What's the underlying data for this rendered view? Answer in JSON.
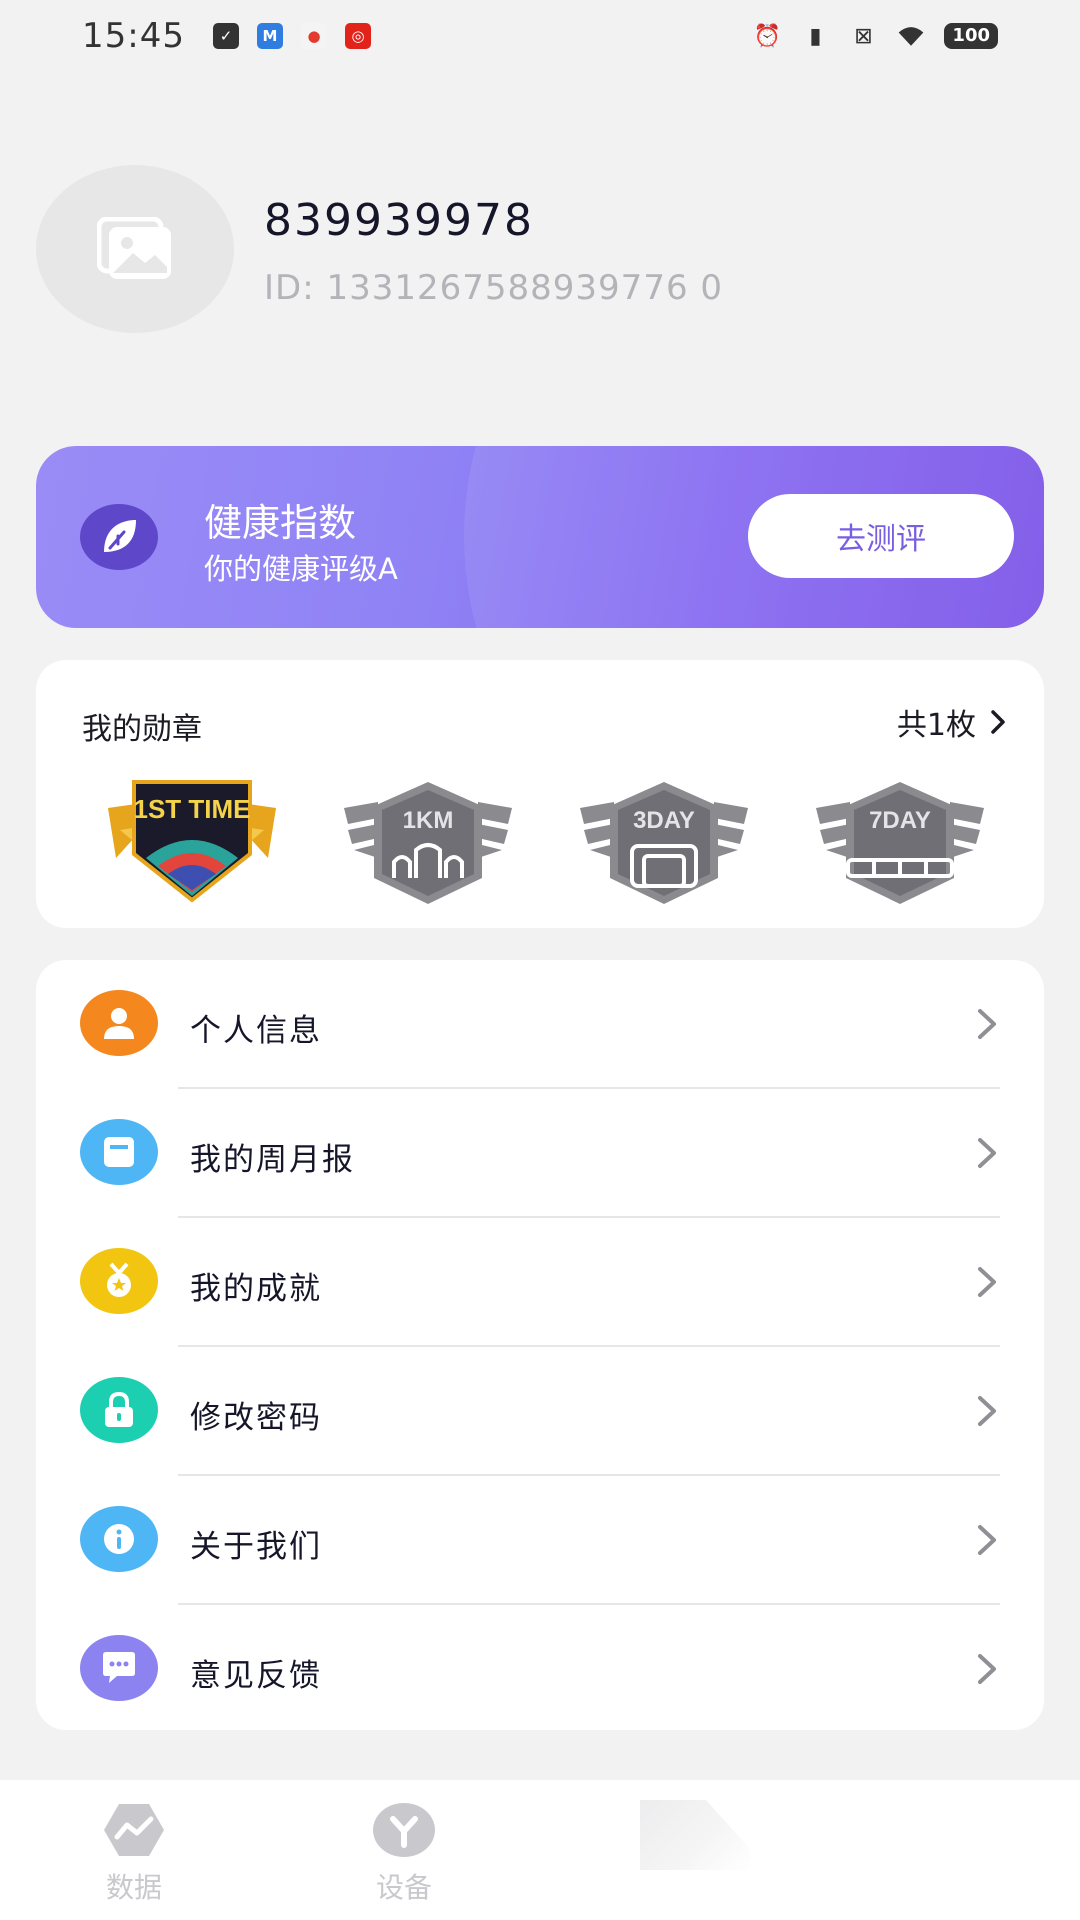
{
  "status_bar": {
    "time": "15:45",
    "battery": "100",
    "apps": [
      "checklist-icon",
      "mountain-app-icon",
      "map-pin-app-icon",
      "music-app-icon"
    ],
    "system_icons": [
      "alarm-icon",
      "vibrate-icon",
      "close-box-icon",
      "wifi-icon"
    ]
  },
  "profile": {
    "username": "839939978",
    "user_id": "ID: 1331267588939776 0"
  },
  "health": {
    "title": "健康指数",
    "subtitle": "你的健康评级A",
    "button": "去测评",
    "icon": "leaf-icon"
  },
  "medals": {
    "title": "我的勋章",
    "count": "共1枚",
    "items": [
      {
        "label": "1ST TIME",
        "earned": true
      },
      {
        "label": "1KM",
        "earned": false
      },
      {
        "label": "3DAY",
        "earned": false
      },
      {
        "label": "7DAY",
        "earned": false
      }
    ]
  },
  "menu": {
    "items": [
      {
        "label": "个人信息",
        "icon": "person-icon",
        "color": "#f5871f"
      },
      {
        "label": "我的周月报",
        "icon": "report-icon",
        "color": "#4fb6f5"
      },
      {
        "label": "我的成就",
        "icon": "medal-icon",
        "color": "#f2c511"
      },
      {
        "label": "修改密码",
        "icon": "lock-icon",
        "color": "#1ccfb0"
      },
      {
        "label": "关于我们",
        "icon": "info-icon",
        "color": "#4fb6f5"
      },
      {
        "label": "意见反馈",
        "icon": "chat-icon",
        "color": "#8c82f0"
      }
    ]
  },
  "bottom_nav": {
    "tabs": [
      {
        "label": "数据",
        "icon": "chart-hexagon-icon"
      },
      {
        "label": "设备",
        "icon": "device-icon"
      }
    ]
  },
  "colors": {
    "accent": "#8466f0",
    "background": "#f2f2f3"
  }
}
